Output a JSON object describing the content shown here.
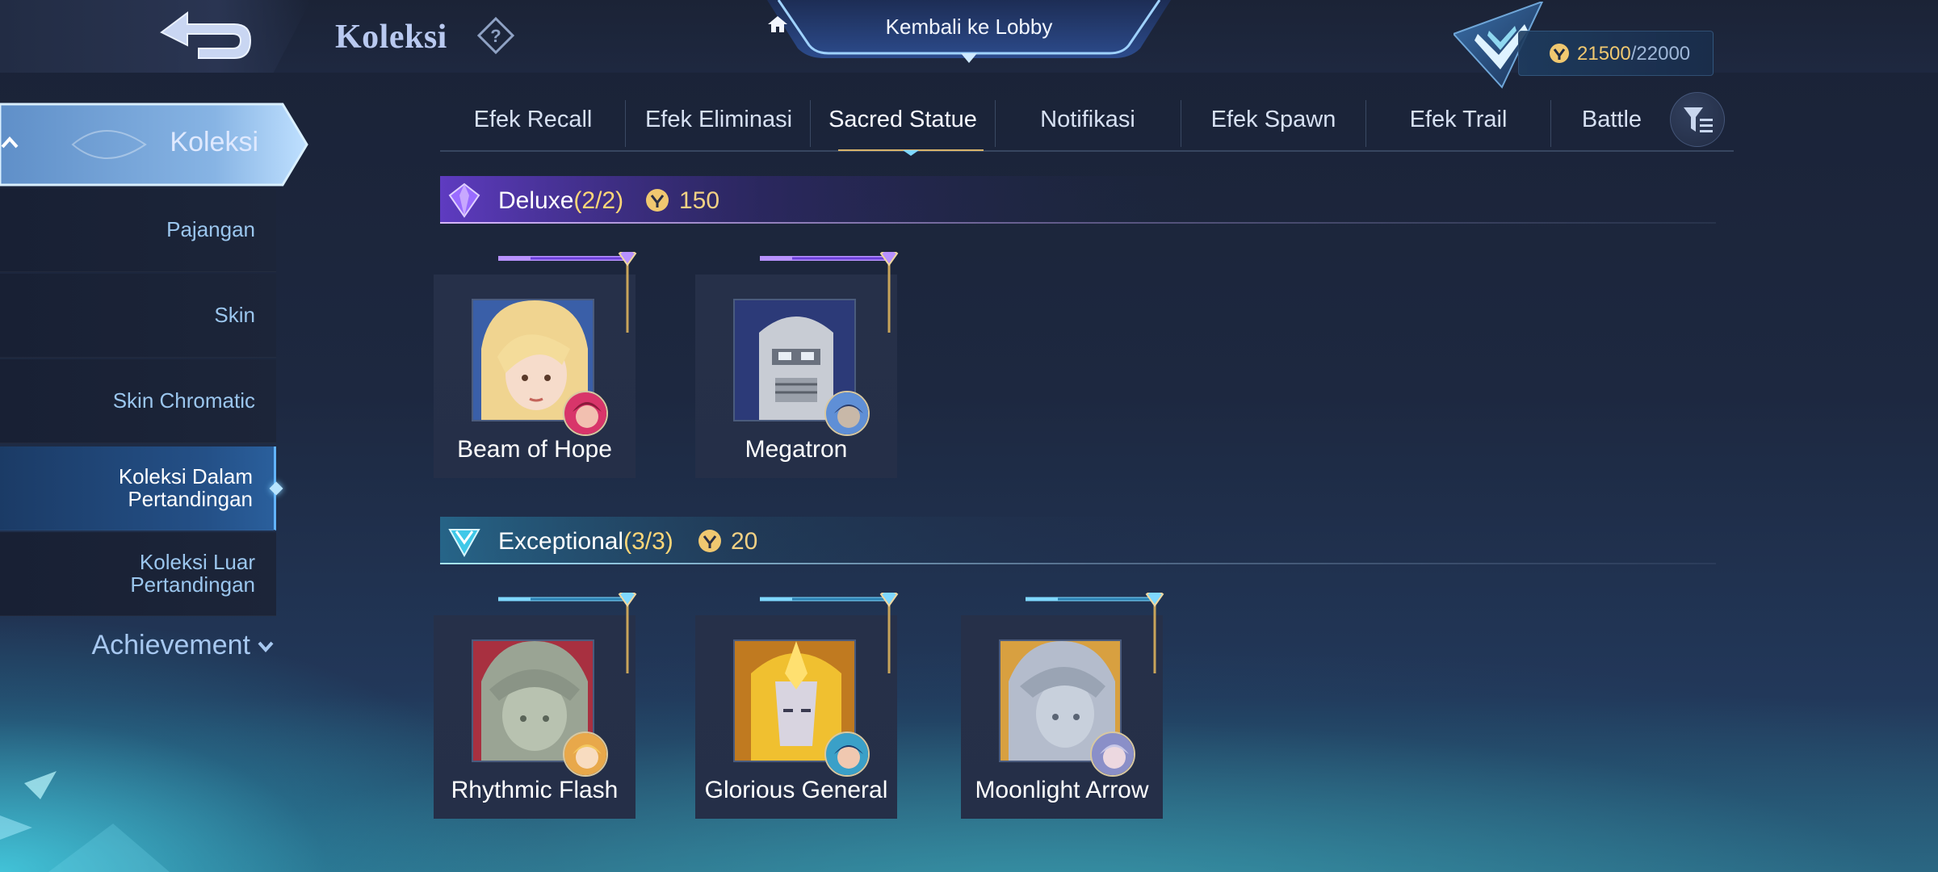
{
  "header": {
    "title": "Koleksi",
    "lobby_label": "Kembali ke Lobby",
    "currency_current": "21500",
    "currency_max": "/22000"
  },
  "sidebar": {
    "main_label": "Koleksi",
    "items": [
      {
        "label": "Pajangan"
      },
      {
        "label": "Skin"
      },
      {
        "label": "Skin Chromatic"
      },
      {
        "label_line1": "Koleksi Dalam",
        "label_line2": "Pertandingan",
        "active": true
      },
      {
        "label_line1": "Koleksi Luar",
        "label_line2": "Pertandingan"
      }
    ],
    "achievement_label": "Achievement"
  },
  "tabs": [
    {
      "label": "Efek Recall"
    },
    {
      "label": "Efek Eliminasi"
    },
    {
      "label": "Sacred Statue",
      "active": true
    },
    {
      "label": "Notifikasi"
    },
    {
      "label": "Efek Spawn"
    },
    {
      "label": "Efek Trail"
    },
    {
      "label": "Battle"
    }
  ],
  "sections": [
    {
      "name": "Deluxe",
      "count": "(2/2)",
      "points": "150",
      "accent": "#9a6cff",
      "items": [
        {
          "name": "Beam of Hope",
          "hero_badge_color": "#d8356a"
        },
        {
          "name": "Megatron",
          "hero_badge_color": "#5f8fd6"
        }
      ]
    },
    {
      "name": "Exceptional",
      "count": "(3/3)",
      "points": "20",
      "accent": "#3fc8e8",
      "items": [
        {
          "name": "Rhythmic Flash",
          "hero_badge_color": "#e8a84a"
        },
        {
          "name": "Glorious General",
          "hero_badge_color": "#3aa0c8"
        },
        {
          "name": "Moonlight Arrow",
          "hero_badge_color": "#8a8fc8"
        }
      ]
    }
  ],
  "colors": {
    "gold": "#f2d184",
    "count_yellow": "#ffd778",
    "sidebar_text": "#9bc6ee",
    "active_blue": "#245087"
  }
}
